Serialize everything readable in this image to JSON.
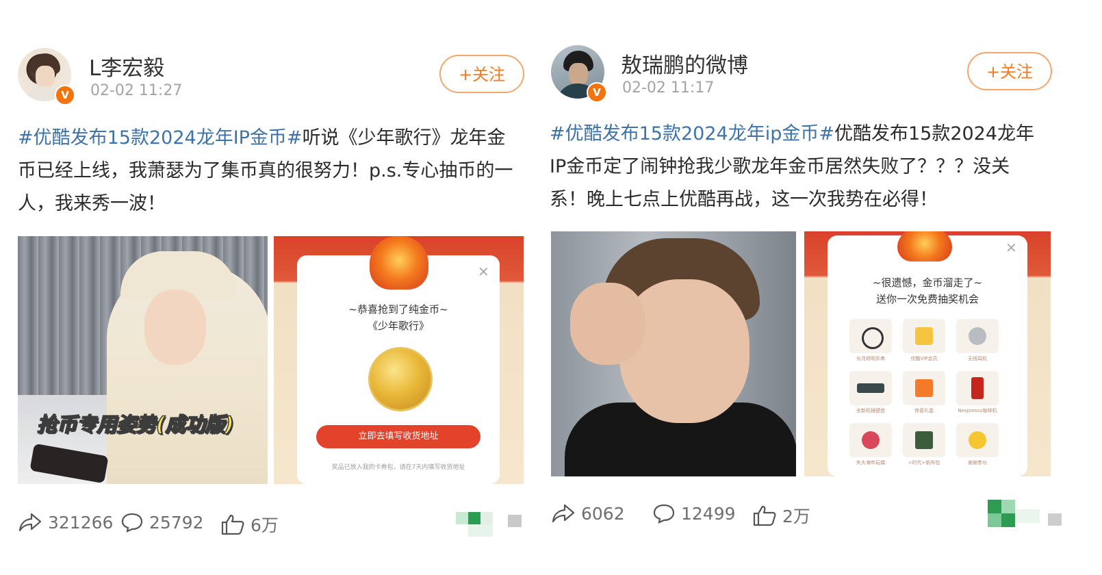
{
  "posts": [
    {
      "username": "L李宏毅",
      "timestamp": "02-02 11:27",
      "follow_label": "+关注",
      "text": {
        "hashtag": "#优酷发布15款2024龙年IP金币#",
        "body": "听说《少年歌行》龙年金币已经上线，我萧瑟为了集币真的很努力！p.s.专心抽币的一人，我来秀一波！"
      },
      "images": [
        {
          "caption": "抢币专用姿势(成功版)"
        },
        {
          "modal_title_1": "~恭喜抢到了纯金币~",
          "modal_title_2": "《少年歌行》",
          "button_label": "立即去填写收货地址",
          "fine_print": "奖品已放入我的卡券包，请在7天内填写收货地址"
        }
      ],
      "repost_count": "321266",
      "comment_count": "25792",
      "like_count": "6万"
    },
    {
      "username": "敖瑞鹏的微博",
      "timestamp": "02-02 11:17",
      "follow_label": "+关注",
      "text": {
        "hashtag": "#优酷发布15款2024龙年ip金币#",
        "body": "优酷发布15款2024龙年IP金币定了闹钟抢我少歌龙年金币居然失败了？？？没关系！晚上七点上优酷再战，这一次我势在必得！"
      },
      "images": [
        {},
        {
          "modal_title_1": "~很遗憾，金币溜走了~",
          "modal_title_2": "送你一次免费抽奖机会",
          "prizes": [
            "长月烬明手串",
            "优酷VIP会员",
            "无线耳机",
            "全新机械键盘",
            "惊喜礼盒",
            "Nespresso咖啡机",
            "失大海年玩偶",
            "<时代>帆布包",
            "谢谢参与"
          ]
        }
      ],
      "repost_count": "6062",
      "comment_count": "12499",
      "like_count": "2万"
    }
  ],
  "colors": {
    "hashtag": "#3d73a8",
    "follow": "#f47b22",
    "verified_badge": "#f2740f",
    "cta": "#e2432a"
  },
  "icons": {
    "repost": "repost-icon",
    "comment": "comment-icon",
    "like": "like-icon",
    "verified": "verified-badge-icon"
  }
}
